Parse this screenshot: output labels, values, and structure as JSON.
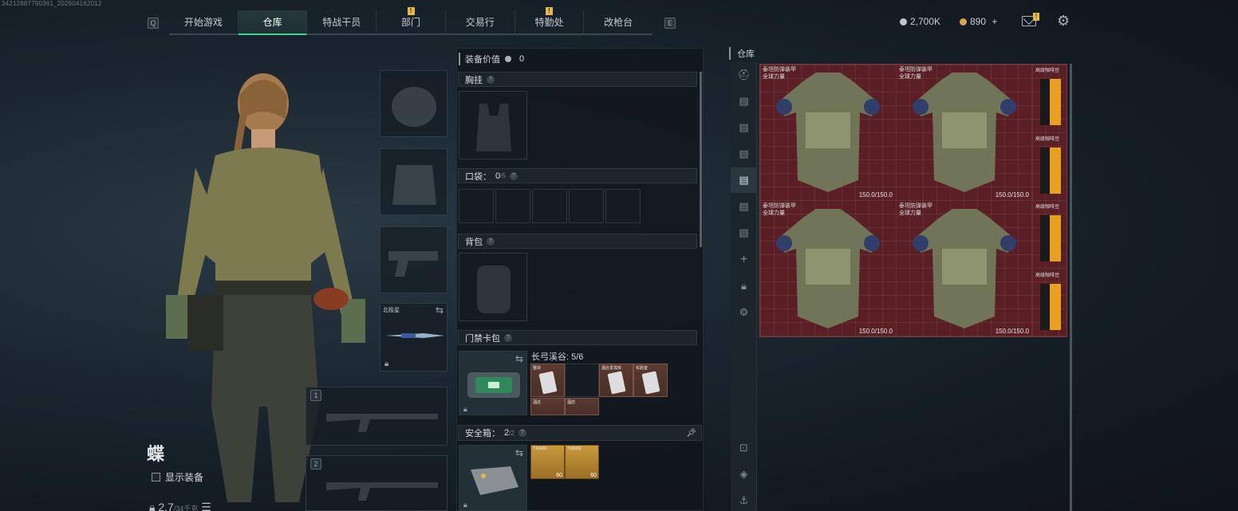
{
  "build_id": "34212887790361_202604162012",
  "nav": {
    "left_key": "Q",
    "right_key": "E",
    "tabs": [
      {
        "label": "开始游戏",
        "active": false,
        "badge": ""
      },
      {
        "label": "仓库",
        "active": true,
        "badge": ""
      },
      {
        "label": "特战干员",
        "active": false,
        "badge": ""
      },
      {
        "label": "部门",
        "active": false,
        "badge": "!"
      },
      {
        "label": "交易行",
        "active": false,
        "badge": ""
      },
      {
        "label": "特勤处",
        "active": false,
        "badge": "!"
      },
      {
        "label": "改枪台",
        "active": false,
        "badge": ""
      }
    ]
  },
  "currency": {
    "primary": "2,700K",
    "secondary": "890",
    "add_label": "+",
    "mail_badge": "!"
  },
  "colors": {
    "accent": "#3fd39a",
    "badge": "#e8b93a",
    "storage_bg": "#5a1f24"
  },
  "operator": {
    "name": "蝶",
    "show_gear_label": "显示装备",
    "weight": "2.7",
    "weight_max": "/34千克"
  },
  "equipment": {
    "melee_name": "北极星",
    "weapon_slot_1": "1",
    "weapon_slot_2": "2"
  },
  "center": {
    "value_label": "装备价值",
    "value": "0",
    "chest_rig_label": "胸挂",
    "pockets_label": "口袋：",
    "pockets_count": "0",
    "pockets_max": "/5",
    "backpack_label": "背包",
    "keycard_label": "门禁卡包",
    "keycard_location": "长弓溪谷: 5/6",
    "keycard_tiles": [
      "整块",
      "酒店贵宾房",
      "实验室"
    ],
    "keycard_tiles_row2": [
      "酒店",
      "酒店"
    ],
    "safebox_label": "安全箱：",
    "safebox_count": "2",
    "safebox_max": "/2",
    "ammo_count_1": "60",
    "ammo_count_2": "60",
    "ammo_name": "7.62x51"
  },
  "storage": {
    "title": "仓库",
    "armor_items": [
      {
        "name": "泰坦防弹装甲",
        "brand": "全球力量",
        "durability": "150.0/150.0"
      },
      {
        "name": "泰坦防弹装甲",
        "brand": "全球力量",
        "durability": "150.0/150.0"
      },
      {
        "name": "泰坦防弹装甲",
        "brand": "全球力量",
        "durability": "150.0/150.0"
      },
      {
        "name": "泰坦防弹装甲",
        "brand": "全球力量",
        "durability": "150.0/150.0"
      }
    ],
    "coffee_label": "高级咖啡豆",
    "sidebar_icons": [
      "helmet-icon",
      "shelf-1-icon",
      "shelf-2-icon",
      "shelf-3-icon",
      "shelf-4-icon",
      "shelf-5-icon",
      "shelf-6-icon",
      "add-icon",
      "lock-icon",
      "settings-icon",
      "sort-icon",
      "layers-icon",
      "anchor-icon"
    ]
  }
}
